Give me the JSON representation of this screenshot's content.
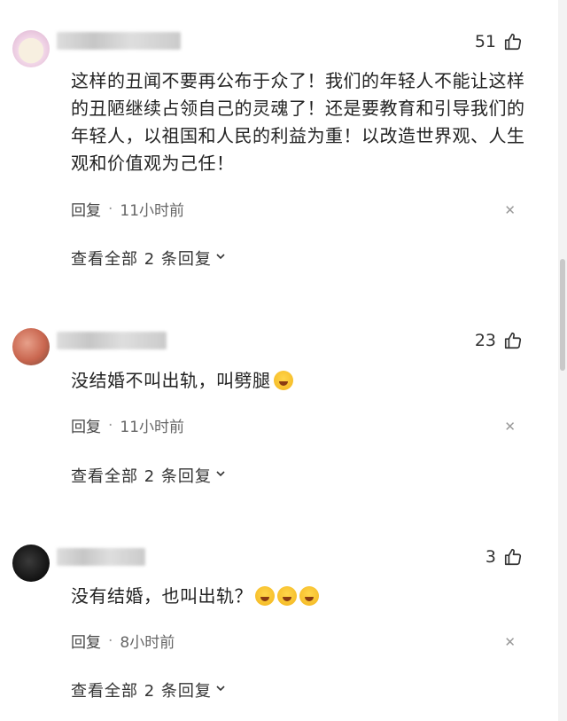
{
  "comments": [
    {
      "likes": "51",
      "text": "这样的丑闻不要再公布于众了！我们的年轻人不能让这样的丑陋继续占领自己的灵魂了！还是要教育和引导我们的年轻人，以祖国和人民的利益为重！以改造世界观、人生观和价值观为己任！",
      "reply_label": "回复",
      "separator": "·",
      "time": "11小时前",
      "close": "✕",
      "view_all": "查看全部 2 条回复",
      "emoji_count": 0
    },
    {
      "likes": "23",
      "text": "没结婚不叫出轨，叫劈腿",
      "reply_label": "回复",
      "separator": "·",
      "time": "11小时前",
      "close": "✕",
      "view_all": "查看全部 2 条回复",
      "emoji_count": 1
    },
    {
      "likes": "3",
      "text": "没有结婚，也叫出轨？",
      "reply_label": "回复",
      "separator": "·",
      "time": "8小时前",
      "close": "✕",
      "view_all": "查看全部 2 条回复",
      "emoji_count": 3
    }
  ],
  "icons": {
    "like": "thumbs-up-icon",
    "expand": "chevron-down-icon",
    "close": "close-icon",
    "emoji": "laughing-crying-emoji-icon"
  },
  "colors": {
    "text": "#222222",
    "meta": "#666666",
    "close": "#9a9a9a",
    "background": "#ffffff"
  }
}
